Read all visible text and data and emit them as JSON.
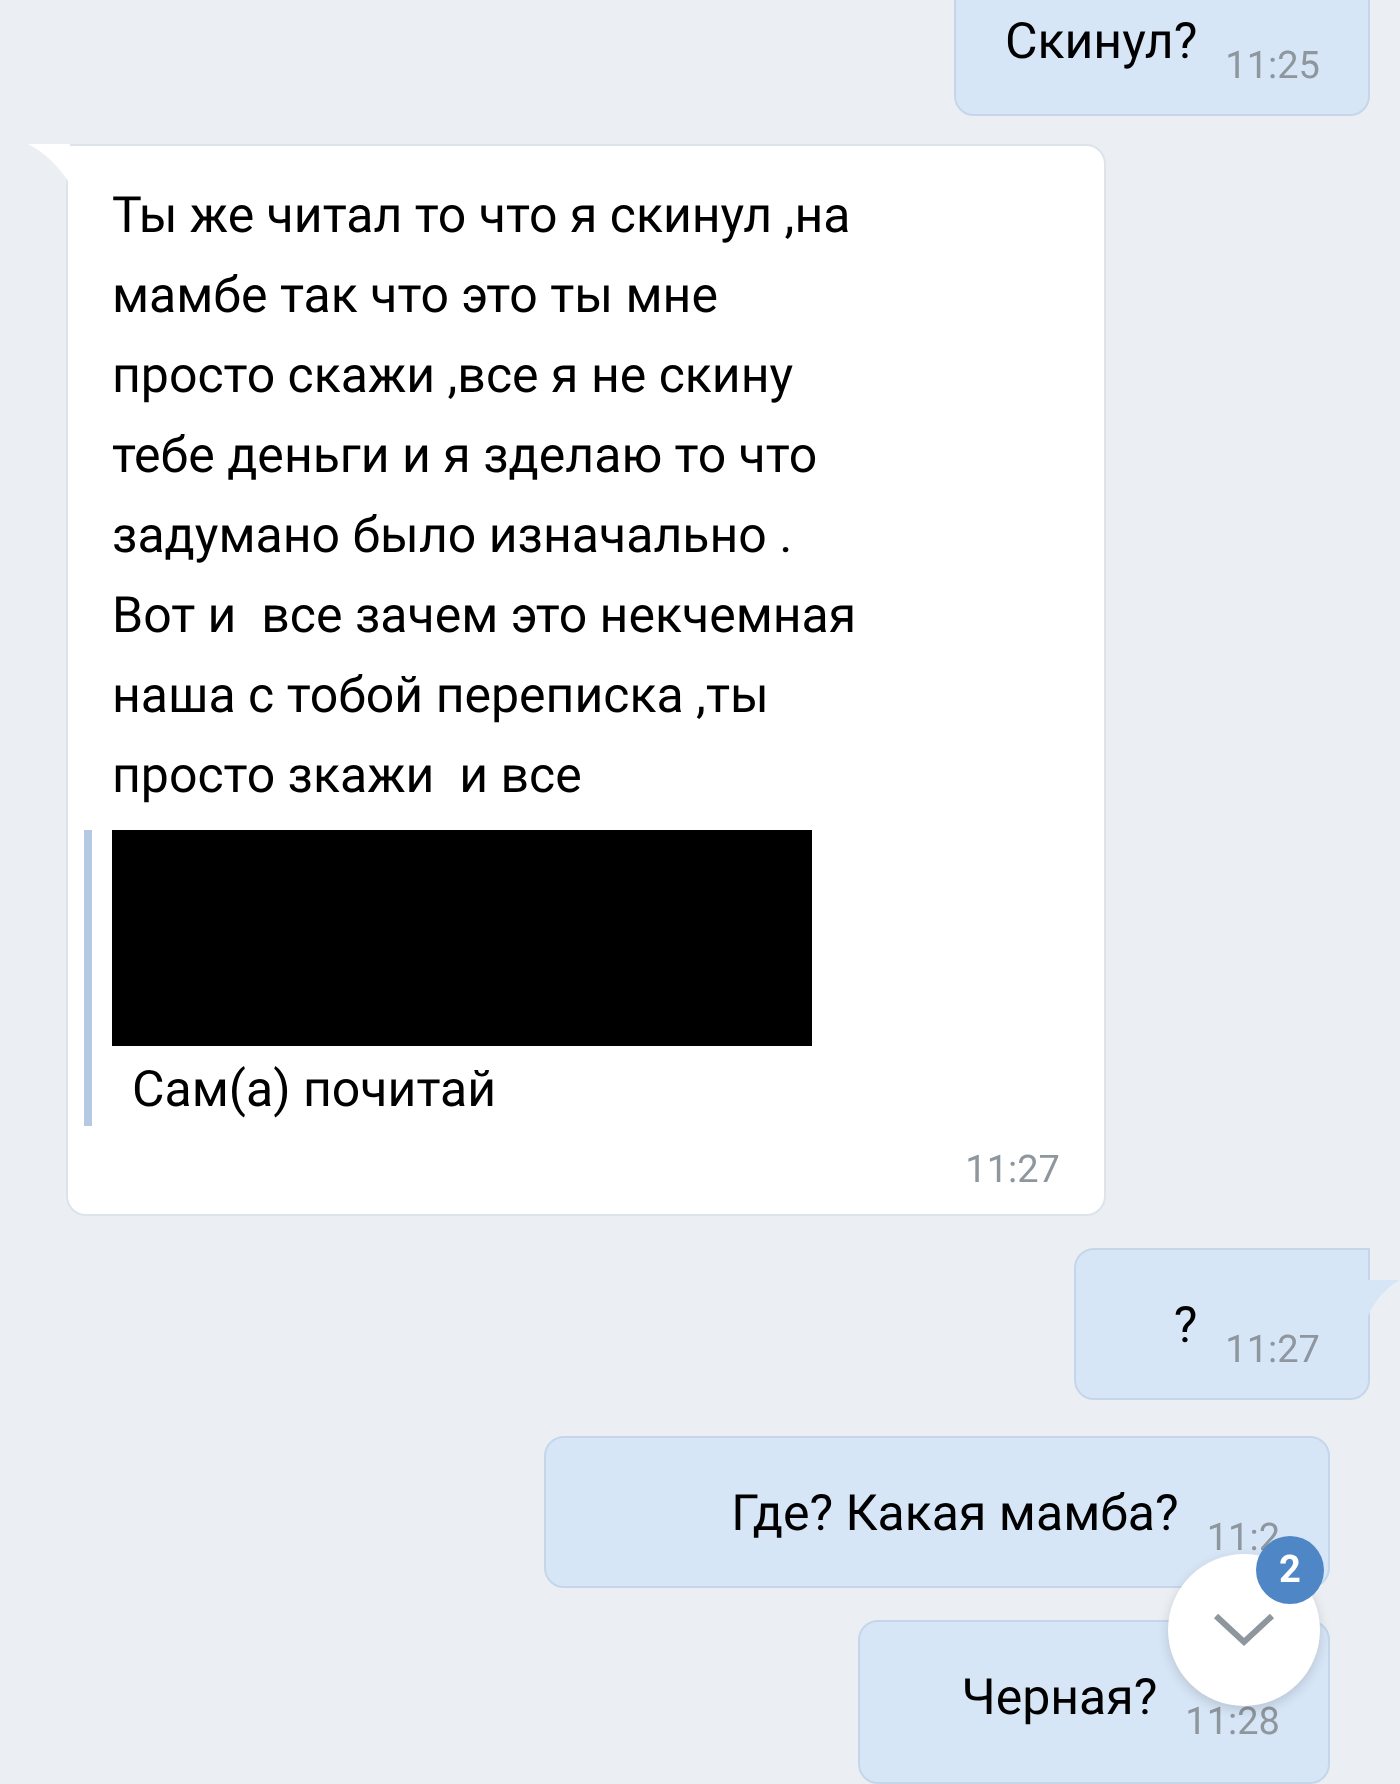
{
  "messages": [
    {
      "kind": "outgoing",
      "text": "Скинул?",
      "time": "11:25"
    },
    {
      "kind": "incoming",
      "text": "Ты же читал то что я скинул ,на\nмамбе так что это ты мне\nпросто скажи ,все я не скину\nтебе деньги и я зделаю то что\nзадумано было изначально .\nВот и  все зачем это некчемная\nнаша с тобой переписка ,ты\nпросто зкажи  и все",
      "quote": {
        "redacted": true,
        "text": "Сам(а) почитай"
      },
      "time": "11:27"
    },
    {
      "kind": "outgoing",
      "text": "?",
      "time": "11:27"
    },
    {
      "kind": "outgoing",
      "text": "Где? Какая мамба?",
      "time": "11:2"
    },
    {
      "kind": "outgoing",
      "text": "Черная?",
      "time": "11:28"
    }
  ],
  "scroll_button": {
    "badge": "2"
  }
}
